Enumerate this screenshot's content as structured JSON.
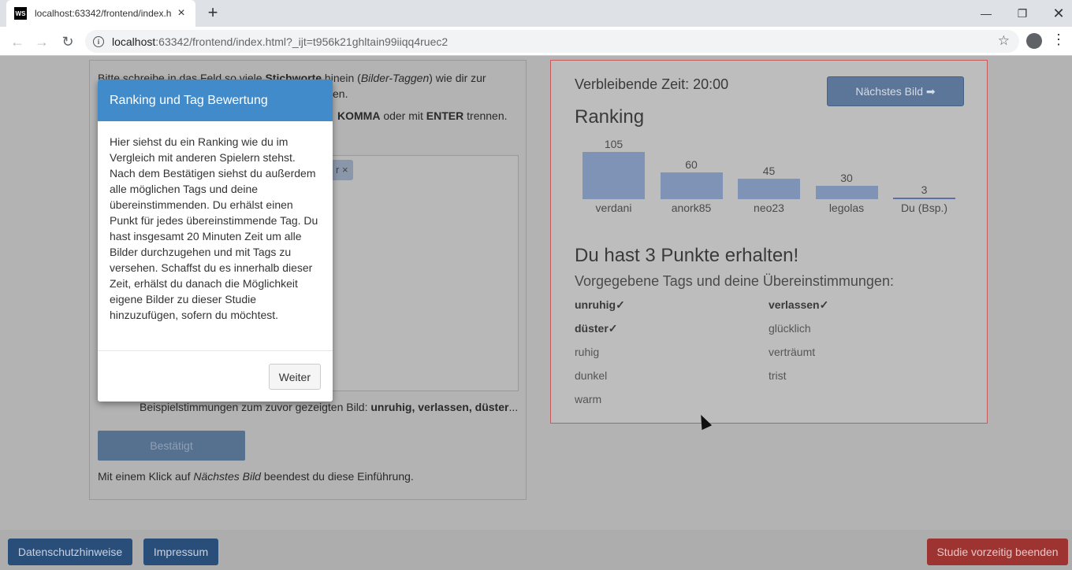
{
  "browser": {
    "tab_title": "localhost:63342/frontend/index.h",
    "favicon_text": "WS",
    "url_host": "localhost",
    "url_rest": ":63342/frontend/index.html?_ijt=t956k21ghltain99iiqq4ruec2"
  },
  "left": {
    "instruction_line1_pre": "Bitte schreibe in das Feld so viele ",
    "instruction_line1_bold": "Stichworte",
    "instruction_line1_mid": " hinein (",
    "instruction_line1_italic": "Bilder-Taggen",
    "instruction_line1_post": ") wie dir zur",
    "instruction_line2_tail": "en.",
    "instruction3_bold1": "KOMMA",
    "instruction3_mid": " oder mit ",
    "instruction3_bold2": "ENTER",
    "instruction3_post": " trennen.",
    "tag_chip": "r ×",
    "beispiel_pre": "Beispielstimmungen zum zuvor gezeigten Bild: ",
    "beispiel_bold": "unruhig, verlassen, düster",
    "beispiel_post": "...",
    "confirm_button": "Bestätigt",
    "klick_pre": "Mit einem Klick auf ",
    "klick_italic": "Nächstes Bild",
    "klick_post": " beendest du diese Einführung."
  },
  "right": {
    "timer": "Verbleibende Zeit: 20:00",
    "next_button": "Nächstes Bild ➡",
    "ranking_title": "Ranking",
    "points_title": "Du hast 3 Punkte erhalten!",
    "tags_subtitle": "Vorgegebene Tags und deine Übereinstimmungen:",
    "tags": [
      {
        "label": "unruhig✓",
        "match": true
      },
      {
        "label": "verlassen✓",
        "match": true
      },
      {
        "label": "düster✓",
        "match": true
      },
      {
        "label": "glücklich",
        "match": false
      },
      {
        "label": "ruhig",
        "match": false
      },
      {
        "label": "verträumt",
        "match": false
      },
      {
        "label": "dunkel",
        "match": false
      },
      {
        "label": "trist",
        "match": false
      },
      {
        "label": "warm",
        "match": false
      }
    ]
  },
  "chart_data": {
    "type": "bar",
    "categories": [
      "verdani",
      "anork85",
      "neo23",
      "legolas",
      "Du (Bsp.)"
    ],
    "values": [
      105,
      60,
      45,
      30,
      3
    ],
    "title": "Ranking",
    "xlabel": "",
    "ylabel": "",
    "ylim": [
      0,
      105
    ],
    "colors": {
      "bar": "#7f93b6",
      "highlight": "#5b6fa8"
    }
  },
  "modal": {
    "title": "Ranking und Tag Bewertung",
    "body": "Hier siehst du ein Ranking wie du im Vergleich mit anderen Spielern stehst. Nach dem Bestätigen siehst du außerdem alle möglichen Tags und deine übereinstimmenden. Du erhälst einen Punkt für jedes übereinstimmende Tag. Du hast insgesamt 20 Minuten Zeit um alle Bilder durchzugehen und mit Tags zu versehen. Schaffst du es innerhalb dieser Zeit, erhälst du danach die Möglichkeit eigene Bilder zu dieser Studie hinzuzufügen, sofern du möchtest.",
    "button": "Weiter"
  },
  "footer": {
    "privacy": "Datenschutzhinweise",
    "imprint": "Impressum",
    "end_study": "Studie vorzeitig beenden"
  }
}
